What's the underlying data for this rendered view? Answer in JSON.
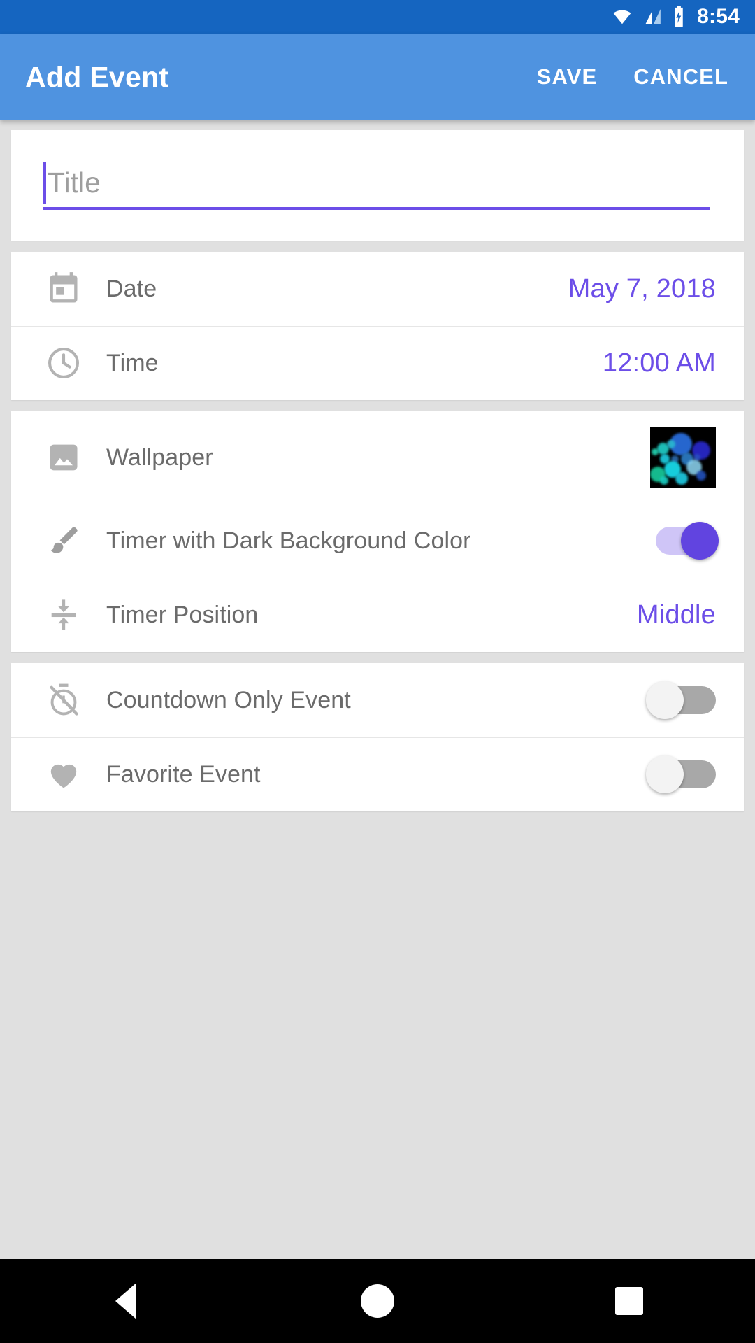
{
  "status_bar": {
    "time": "8:54",
    "icons": [
      "wifi-icon",
      "cell-signal-icon",
      "battery-charging-icon"
    ],
    "background_color": "#1565c0"
  },
  "app_bar": {
    "title": "Add Event",
    "save_label": "SAVE",
    "cancel_label": "CANCEL",
    "background_color": "#4f93e0"
  },
  "theme": {
    "accent_color": "#6c4ee8",
    "page_background": "#e0e0e0",
    "card_background": "#ffffff",
    "label_color": "#6b6b6b"
  },
  "form": {
    "title_field": {
      "value": "",
      "placeholder": "Title",
      "focused": true
    },
    "datetime_group": [
      {
        "icon": "calendar-icon",
        "label": "Date",
        "value": "May 7, 2018"
      },
      {
        "icon": "clock-icon",
        "label": "Time",
        "value": "12:00 AM"
      }
    ],
    "appearance_group": [
      {
        "icon": "image-icon",
        "label": "Wallpaper",
        "value_type": "thumbnail"
      },
      {
        "icon": "brush-icon",
        "label": "Timer with Dark Background Color",
        "value_type": "switch",
        "switch_state": "on"
      },
      {
        "icon": "vertical-align-center-icon",
        "label": "Timer Position",
        "value": "Middle"
      }
    ],
    "options_group": [
      {
        "icon": "timer-off-icon",
        "label": "Countdown Only Event",
        "value_type": "switch",
        "switch_state": "off"
      },
      {
        "icon": "heart-icon",
        "label": "Favorite Event",
        "value_type": "switch",
        "switch_state": "off"
      }
    ]
  },
  "nav_bar": {
    "back_label": "Back",
    "home_label": "Home",
    "recents_label": "Recents"
  }
}
